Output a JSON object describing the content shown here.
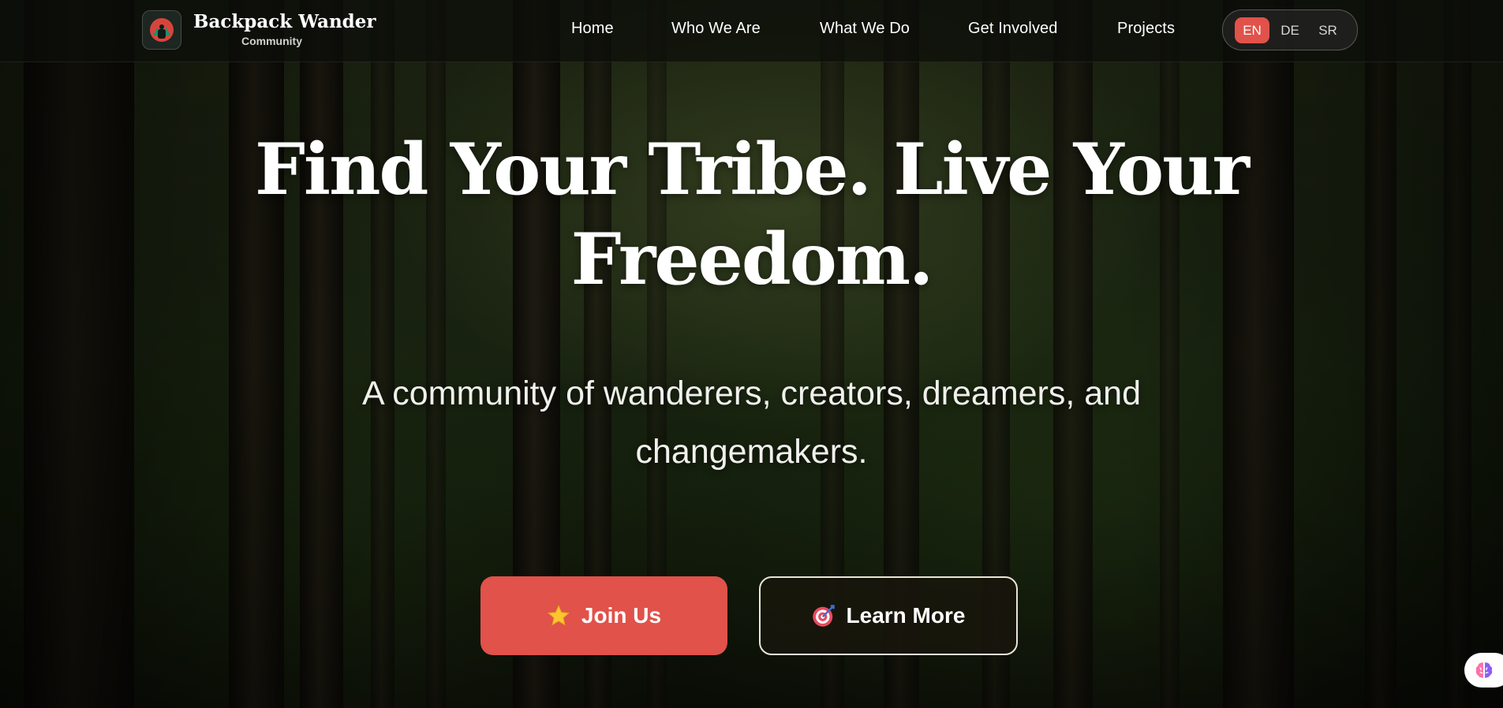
{
  "brand": {
    "name": "Backpack Wander",
    "tagline": "Community"
  },
  "nav": {
    "items": [
      {
        "label": "Home"
      },
      {
        "label": "Who We Are"
      },
      {
        "label": "What We Do"
      },
      {
        "label": "Get Involved"
      },
      {
        "label": "Projects"
      }
    ]
  },
  "language_switcher": {
    "options": [
      "EN",
      "DE",
      "SR"
    ],
    "selected": "EN"
  },
  "hero": {
    "title": "Find Your Tribe. Live Your Freedom.",
    "subtitle": "A community of wanderers, creators, dreamers, and changemakers.",
    "join_button": {
      "icon": "star-icon",
      "label": "Join Us"
    },
    "learn_button": {
      "icon": "target-icon",
      "label": "Learn More"
    }
  },
  "floating_widget": {
    "icon": "brain-icon"
  },
  "colors": {
    "accent": "#e0524a",
    "header_bg": "#0c0e0a",
    "text": "#ffffff"
  }
}
